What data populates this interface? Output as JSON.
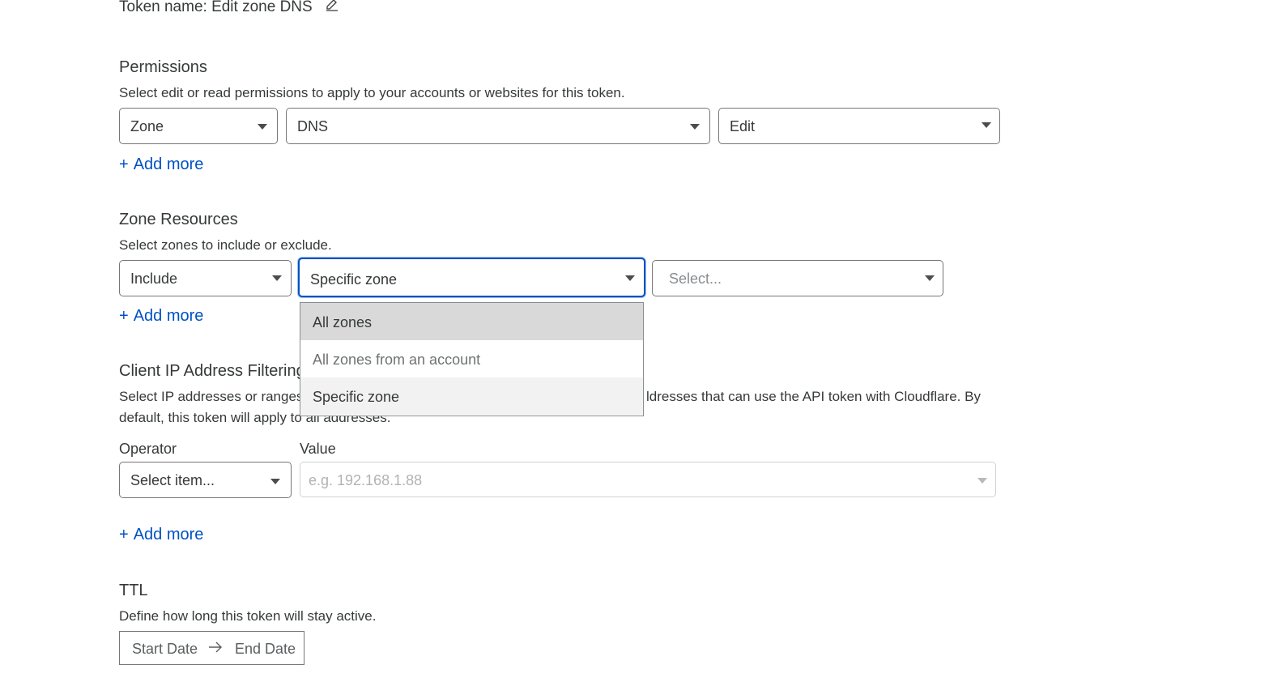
{
  "token": {
    "label": "Token name: Edit zone DNS",
    "edit_icon": "pencil-icon"
  },
  "permissions": {
    "title": "Permissions",
    "description": "Select edit or read permissions to apply to your accounts or websites for this token.",
    "scope": "Zone",
    "resource": "DNS",
    "access": "Edit",
    "add_more": "Add more"
  },
  "zone_resources": {
    "title": "Zone Resources",
    "description": "Select zones to include or exclude.",
    "mode": "Include",
    "type": "Specific zone",
    "zone_placeholder": "Select...",
    "add_more": "Add more",
    "dropdown_options": [
      "All zones",
      "All zones from an account",
      "Specific zone"
    ]
  },
  "ip_filtering": {
    "title": "Client IP Address Filtering",
    "description_left": "Select IP addresses or ranges",
    "description_right": "ldresses that can use the API token with Cloudflare. By",
    "description_line2_left": "default, this token will apply t",
    "description_line2_right": "o all addresses.",
    "operator_label": "Operator",
    "value_label": "Value",
    "operator_placeholder": "Select item...",
    "value_placeholder": "e.g. 192.168.1.88",
    "add_more": "Add more"
  },
  "ttl": {
    "title": "TTL",
    "description": "Define how long this token will stay active.",
    "start": "Start Date",
    "end": "End Date"
  },
  "colors": {
    "link": "#0051c3",
    "focus": "#0051c3",
    "text": "#36393a"
  }
}
